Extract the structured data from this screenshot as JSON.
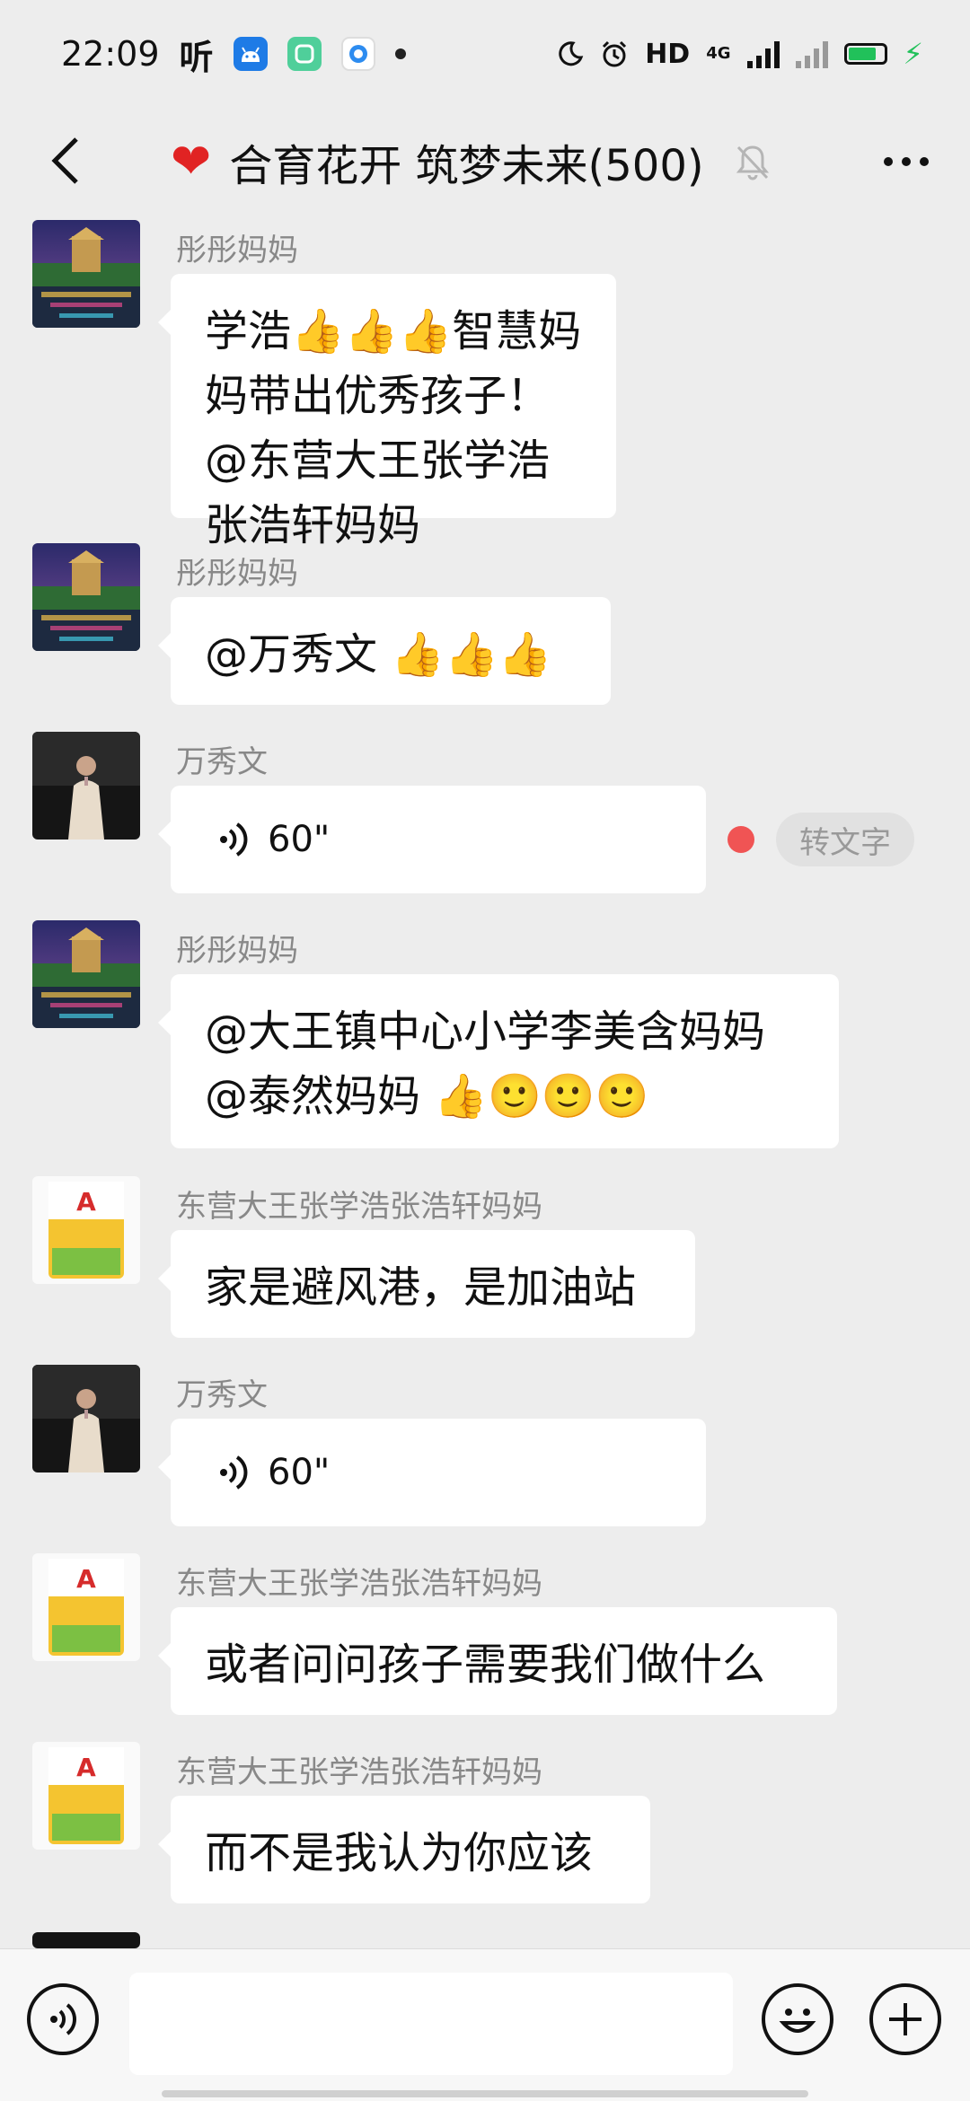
{
  "status_bar": {
    "time": "22:09",
    "listen_icon_text": "听",
    "network": "HD",
    "network_type": "4G"
  },
  "header": {
    "title": "合育花开 筑梦未来(500)",
    "back_icon": "chevron-left-icon",
    "more_icon": "more-dots-icon",
    "mute_icon": "bell-off-icon"
  },
  "messages": [
    {
      "sender": "彤彤妈妈",
      "avatar": "night-lake-pavilion",
      "type": "text",
      "text": "学浩👍👍👍智慧妈妈带出优秀孩子！@东营大王张学浩张浩轩妈妈"
    },
    {
      "sender": "彤彤妈妈",
      "avatar": "night-lake-pavilion",
      "type": "text",
      "text": "@万秀文 👍👍👍"
    },
    {
      "sender": "万秀文",
      "avatar": "woman-portrait",
      "type": "voice",
      "duration": "60\"",
      "convert_label": "转文字",
      "unread": true
    },
    {
      "sender": "彤彤妈妈",
      "avatar": "night-lake-pavilion",
      "type": "text",
      "line1": "@大王镇中心小学李美含妈妈",
      "line2": "@泰然妈妈 👍🙂🙂🙂"
    },
    {
      "sender": "东营大王张学浩张浩轩妈妈",
      "avatar": "detergent-package",
      "type": "text",
      "text": "家是避风港，是加油站"
    },
    {
      "sender": "万秀文",
      "avatar": "woman-portrait",
      "type": "voice",
      "duration": "60\""
    },
    {
      "sender": "东营大王张学浩张浩轩妈妈",
      "avatar": "detergent-package",
      "type": "text",
      "text": "或者问问孩子需要我们做什么"
    },
    {
      "sender": "东营大王张学浩张浩轩妈妈",
      "avatar": "detergent-package",
      "type": "text",
      "text": "而不是我认为你应该"
    }
  ],
  "input_bar": {
    "voice_icon": "voice-input-icon",
    "emoji_icon": "emoji-icon",
    "plus_icon": "plus-icon"
  },
  "colors": {
    "background": "#ededed",
    "bubble": "#ffffff",
    "sender": "#888888",
    "unread_dot": "#f05454",
    "battery": "#21c15a"
  },
  "battery_level": 0.8
}
